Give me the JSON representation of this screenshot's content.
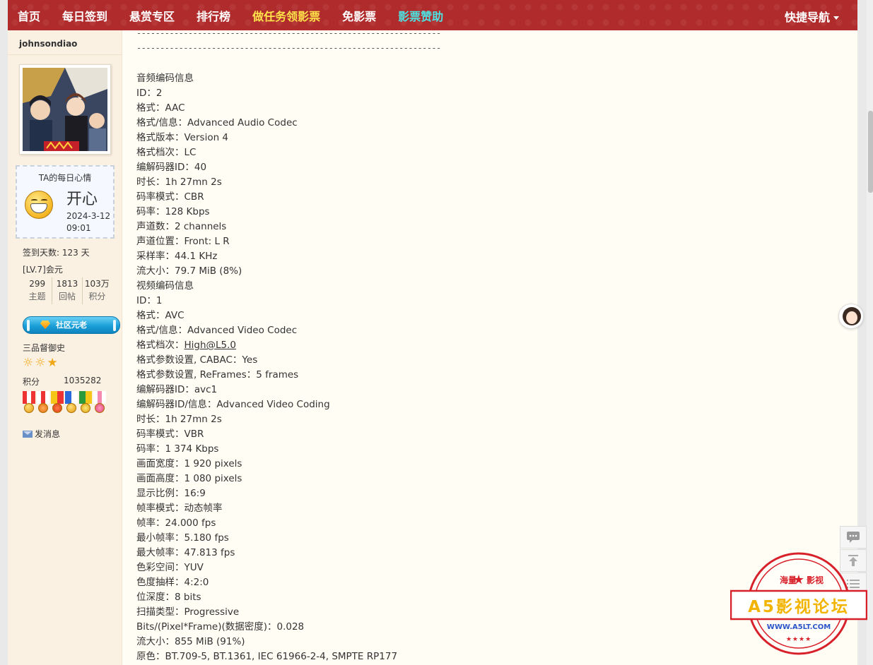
{
  "nav": {
    "items": [
      {
        "label": "首页",
        "style": "white"
      },
      {
        "label": "每日签到",
        "style": "white"
      },
      {
        "label": "悬赏专区",
        "style": "white"
      },
      {
        "label": "排行榜",
        "style": "white"
      },
      {
        "label": "做任务领影票",
        "style": "yellow"
      },
      {
        "label": "免影票",
        "style": "white"
      },
      {
        "label": "影票赞助",
        "style": "cyan"
      }
    ],
    "quick_nav": "快捷导航"
  },
  "user": {
    "name": "johnsondiao",
    "mood_title": "TA的每日心情",
    "mood": "开心",
    "mood_date": "2024-3-12 09:01",
    "signin_days": "签到天数: 123 天",
    "level": "[LV.7]会元",
    "counts": [
      {
        "num": "299",
        "label": "主题"
      },
      {
        "num": "1813",
        "label": "回帖"
      },
      {
        "num": "103万",
        "label": "积分"
      }
    ],
    "badge": "社区元老",
    "rank": "三品督御史",
    "score_label": "积分",
    "score_value": "1035282",
    "send_message": "发消息"
  },
  "post": {
    "lines": [
      "音频编码信息",
      "ID：2",
      "格式：AAC",
      "格式/信息：Advanced Audio Codec",
      "格式版本：Version 4",
      "格式档次：LC",
      "编解码器ID：40",
      "时长：1h 27mn 2s",
      "码率模式：CBR",
      "码率：128 Kbps",
      "声道数：2 channels",
      "声道位置：Front: L R",
      "采样率：44.1 KHz",
      "流大小：79.7 MiB (8%)",
      "视频编码信息",
      "ID：1",
      "格式：AVC",
      "格式/信息：Advanced Video Codec",
      "格式档次：",
      "格式参数设置, CABAC：Yes",
      "格式参数设置, ReFrames：5 frames",
      "编解码器ID：avc1",
      "编解码器ID/信息：Advanced Video Coding",
      "时长：1h 27mn 2s",
      "码率模式：VBR",
      "码率：1 374 Kbps",
      "画面宽度：1 920 pixels",
      "画面高度：1 080 pixels",
      "显示比例：16:9",
      "帧率模式：动态帧率",
      "帧率：24.000 fps",
      "最小帧率：5.180 fps",
      "最大帧率：47.813 fps",
      "色彩空间：YUV",
      "色度抽样：4:2:0",
      "位深度：8 bits",
      "扫描类型：Progressive",
      "Bits/(Pixel*Frame)(数据密度)：0.028",
      "流大小：855 MiB (91%)",
      "原色：BT.709-5, BT.1361, IEC 61966-2-4, SMPTE RP177"
    ],
    "profile_link": "High@L5.0",
    "separator": "----------------------------------------------------------------------------------"
  },
  "stamp": {
    "top_left": "海量",
    "top_right": "影视",
    "name": "A5影视论坛",
    "url": "WWW.A5LT.COM"
  },
  "icons": {
    "quick_nav_caret": "chevron-down-icon",
    "mood": "grin-face-icon",
    "message": "envelope-icon",
    "comment": "comment-icon",
    "top": "back-to-top-icon",
    "list": "list-icon"
  },
  "colors": {
    "nav_bg": "#b02b2b",
    "nav_yellow": "#ffe14a",
    "nav_cyan": "#4de3e3",
    "sidebar_bg": "#fbf1e3",
    "content_bg": "#fffdf4",
    "stamp_red": "#d8202a"
  }
}
